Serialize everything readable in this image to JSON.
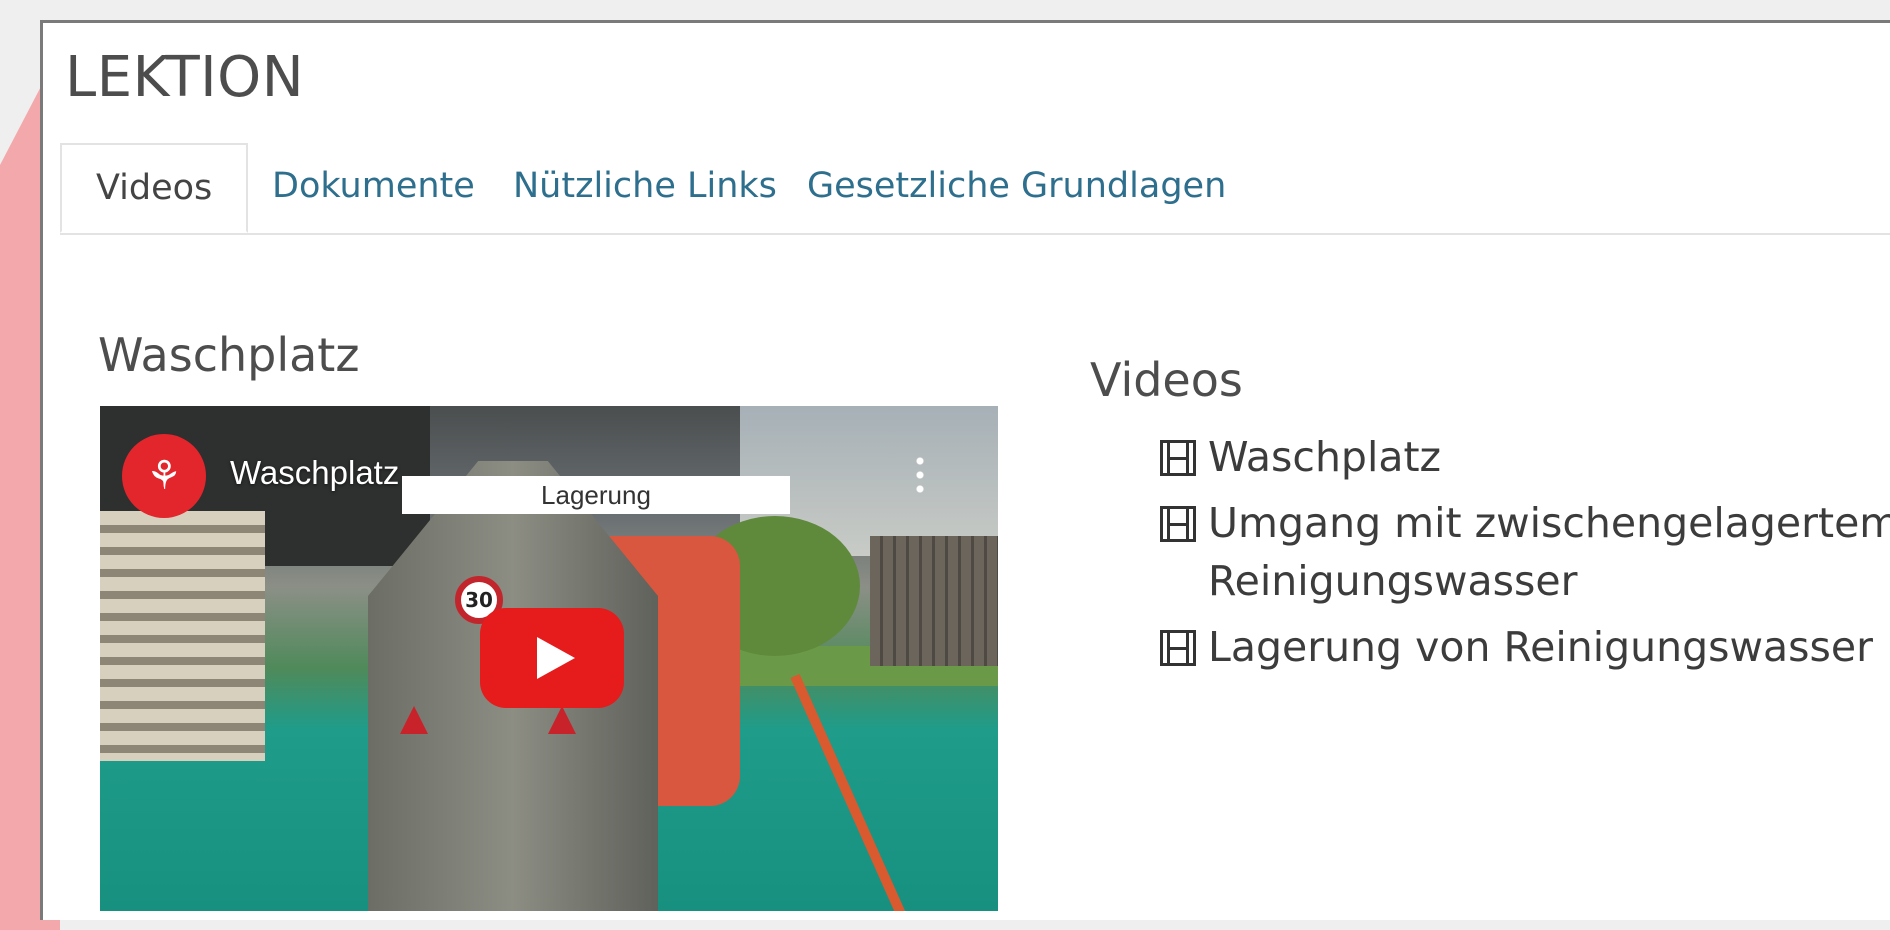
{
  "lesson": {
    "title": "LEKTION"
  },
  "tabs": [
    {
      "label": "Videos",
      "active": true
    },
    {
      "label": "Dokumente",
      "active": false
    },
    {
      "label": "Nützliche Links",
      "active": false
    },
    {
      "label": "Gesetzliche Grundlagen",
      "active": false
    }
  ],
  "video": {
    "heading": "Waschplatz",
    "channel_name": "Waschplatz",
    "overlay_label": "Lagerung",
    "speed_sign": "30",
    "channel_icon": "people-logo-icon",
    "play_icon": "play-icon"
  },
  "list": {
    "heading": "Videos",
    "items": [
      {
        "icon": "film-icon",
        "label": "Waschplatz"
      },
      {
        "icon": "film-icon",
        "label": "Umgang mit zwischengelagertem Reinigungswasser"
      },
      {
        "icon": "film-icon",
        "label": "Lagerung von Reinigungswasser"
      }
    ]
  },
  "colors": {
    "accent_link": "#2e6f8e",
    "youtube_red": "#e61b1b",
    "decoration_pink": "#f3a9ab"
  }
}
